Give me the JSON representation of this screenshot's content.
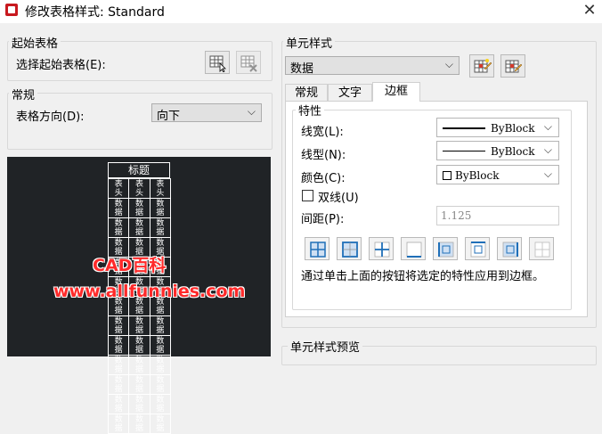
{
  "window": {
    "title": "修改表格样式: Standard",
    "close_symbol": "✕"
  },
  "start_table": {
    "group_title": "起始表格",
    "select_label": "选择起始表格(E):"
  },
  "general": {
    "group_title": "常规",
    "direction_label": "表格方向(D):",
    "direction_value": "向下"
  },
  "preview_table": {
    "title": "标题",
    "header_cell": "表\n头",
    "data_cell": "数\n据",
    "data_rows": 12
  },
  "watermark": {
    "line1": "CAD百科",
    "line2": "www.allfunnies.com"
  },
  "cell_style": {
    "group_title": "单元样式",
    "selected": "数据",
    "tabs": [
      {
        "label": "常规"
      },
      {
        "label": "文字"
      },
      {
        "label": "边框"
      }
    ],
    "active_tab": "边框"
  },
  "border_props": {
    "group_title": "特性",
    "lineweight_label": "线宽(L):",
    "lineweight_value": "ByBlock",
    "linetype_label": "线型(N):",
    "linetype_value": "ByBlock",
    "color_label": "颜色(C):",
    "color_value": "ByBlock",
    "double_line_label": "双线(U)",
    "spacing_label": "间距(P):",
    "spacing_value": "1.125",
    "hint": "通过单击上面的按钮将选定的特性应用到边框。"
  },
  "cell_preview": {
    "group_title": "单元样式预览"
  },
  "icons": {
    "select_table": "select-table-icon",
    "delete_table": "delete-table-icon",
    "new_cell_style": "new-cell-style-icon",
    "manage_cell_styles": "manage-cell-styles-icon",
    "border_buttons": [
      "all-borders-icon",
      "outside-borders-icon",
      "inside-borders-icon",
      "bottom-border-icon",
      "left-border-icon",
      "top-border-icon",
      "right-border-icon",
      "no-border-icon"
    ]
  },
  "colors": {
    "preview_bg": "#202326",
    "watermark": "#ff2a2a",
    "icon_blue": "#1f6fb8",
    "icon_red": "#d33a2c"
  }
}
